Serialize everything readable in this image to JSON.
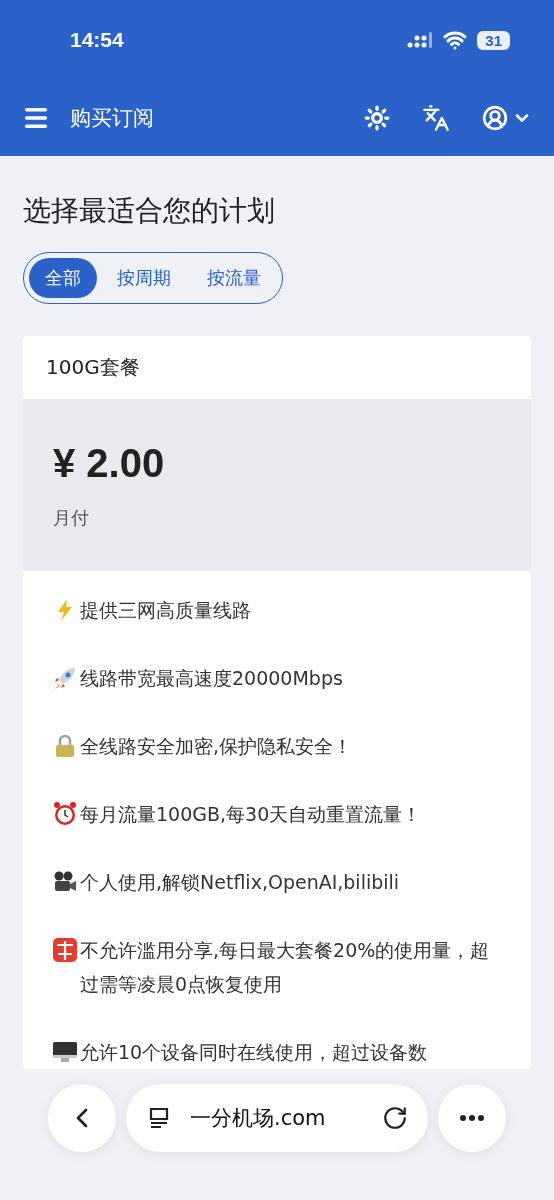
{
  "status_bar": {
    "time": "14:54",
    "battery": "31"
  },
  "header": {
    "title": "购买订阅"
  },
  "page": {
    "heading": "选择最适合您的计划"
  },
  "filter_tabs": [
    {
      "label": "全部",
      "selected": true
    },
    {
      "label": "按周期",
      "selected": false
    },
    {
      "label": "按流量",
      "selected": false
    }
  ],
  "plan": {
    "name": "100G套餐",
    "price": "¥ 2.00",
    "period": "月付",
    "features": [
      {
        "kind": "lightning",
        "text": "提供三网高质量线路"
      },
      {
        "kind": "rocket",
        "text": "线路带宽最高速度20000Mbps"
      },
      {
        "kind": "lock",
        "text": "全线路安全加密,保护隐私安全！"
      },
      {
        "kind": "alarm",
        "text": "每月流量100GB,每30天自动重置流量！"
      },
      {
        "kind": "camera",
        "text": "个人使用,解锁Netflix,OpenAI,bilibili"
      },
      {
        "kind": "prohibited",
        "text": "不允许滥用分享,每日最大套餐20%的使用量，超过需等凌晨0点恢复使用"
      },
      {
        "kind": "monitor",
        "text": "允许10个设备同时在线使用，超过设备数"
      }
    ]
  },
  "browser_bar": {
    "url": "一分机场.com"
  }
}
